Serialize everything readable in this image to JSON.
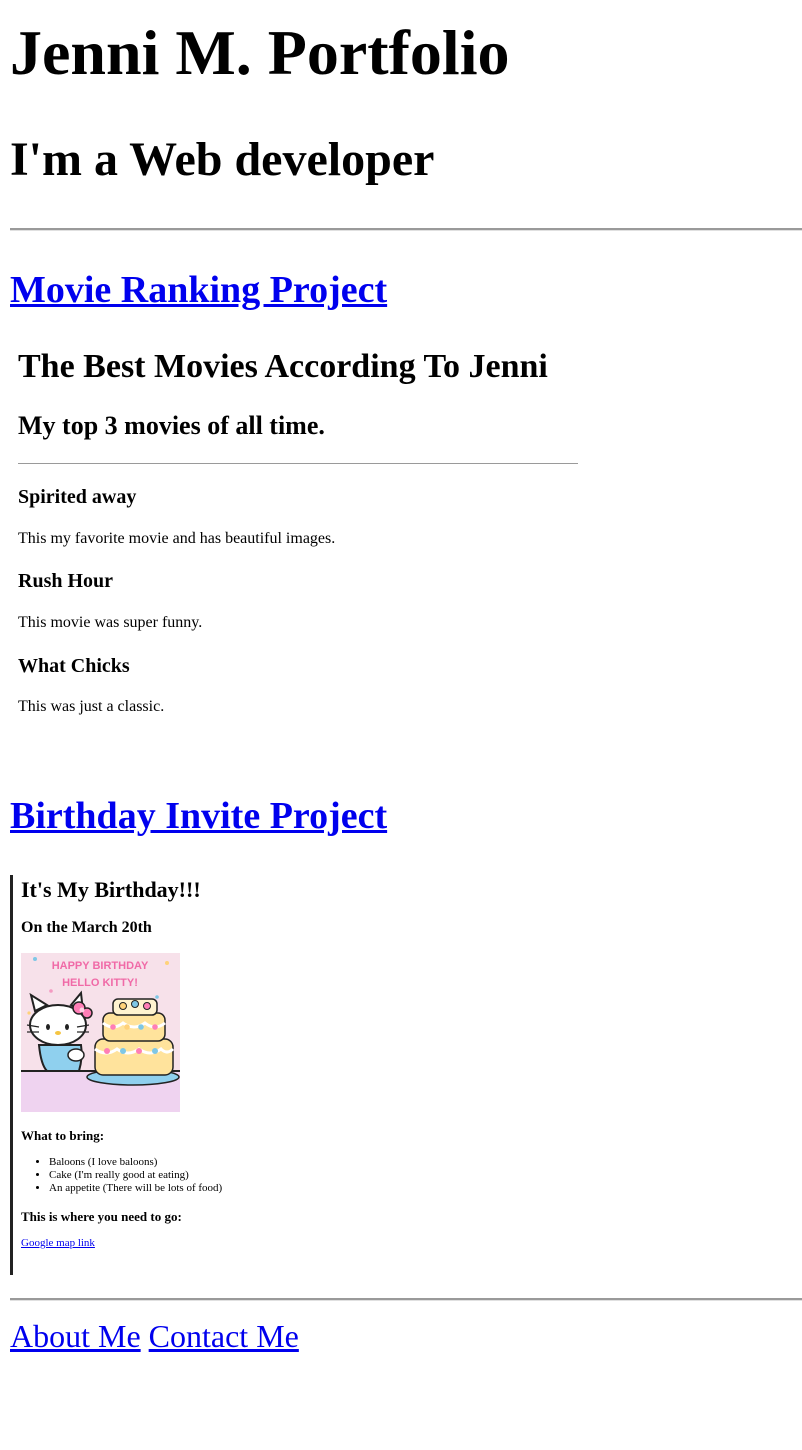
{
  "header": {
    "title": "Jenni M. Portfolio",
    "subtitle": "I'm a Web developer"
  },
  "projects": {
    "movie_link": "Movie Ranking Project",
    "birthday_link": "Birthday Invite Project"
  },
  "movie_page": {
    "title": "The Best Movies According To Jenni",
    "subtitle": "My top 3 movies of all time.",
    "movies": [
      {
        "name": "Spirited away",
        "description": "This my favorite movie and has beautiful images."
      },
      {
        "name": "Rush Hour",
        "description": "This movie was super funny."
      },
      {
        "name": "What Chicks",
        "description": "This was just a classic."
      }
    ]
  },
  "birthday_page": {
    "title": "It's My Birthday!!!",
    "date": "On the March 20th",
    "image_text": {
      "line1": "HAPPY BIRTHDAY",
      "line2": "HELLO KITTY!"
    },
    "bring_label": "What to bring:",
    "bring_items": [
      "Baloons (I love baloons)",
      "Cake (I'm really good at eating)",
      "An appetite (There will be lots of food)"
    ],
    "go_label": "This is where you need to go:",
    "map_link": "Google map link"
  },
  "footer": {
    "about": "About Me",
    "contact": "Contact Me"
  }
}
